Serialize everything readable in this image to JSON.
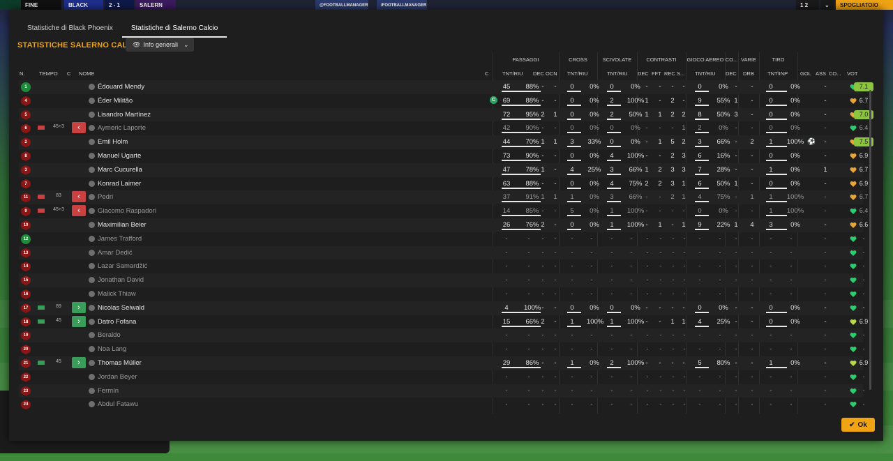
{
  "topbar": {
    "status": "FINE PARTITA",
    "home": "BLACK",
    "score": "2 - 1",
    "away": "SALERN",
    "social1": "@FOOTBALLMANAGER",
    "social2": "/FOOTBALLMANAGER",
    "right_score": "1 2",
    "right_btn": "SPOGLIATOIO"
  },
  "tabs": [
    "Statistiche di Black Phoenix",
    "Statistiche di Salerno Calcio"
  ],
  "title": "STATISTICHE SALERNO CALCIO",
  "view_select": "Info generali",
  "groups": {
    "passaggi": "PASSAGGI",
    "cross": "CROSS",
    "scivolate": "SCIVOLATE",
    "contrasti": "CONTRASTI",
    "aereo": "GIOCO AEREO",
    "co": "CO...",
    "varie": "VARIE",
    "tiro": "TIRO"
  },
  "headers": {
    "n": "N.",
    "tempo": "TEMPO",
    "c": "C",
    "nome": "NOME",
    "cap": "C",
    "tnt_riu": "TNT/RIU",
    "dec": "DEC",
    "ocn": "OCN",
    "cross_tnt": "TNT/RIU",
    "sci_tnt": "TNT/RIU",
    "c_dec": "DEC",
    "c_fft": "FFT",
    "c_rec": "REC",
    "c_s": "S...",
    "aer_tnt": "TNT/RIU",
    "co_dec": "DEC",
    "drb": "DRB",
    "tiro_tnt": "TNT\\INP",
    "gol": "GOL",
    "ass": "ASS",
    "cond": "CO...",
    "vot": "VOT"
  },
  "players": [
    {
      "n": "1",
      "gk": true,
      "tempo": "",
      "sub": "",
      "name": "Édouard Mendy",
      "dim": false,
      "cap": false,
      "p": [
        "45",
        "88%"
      ],
      "pdec": "-",
      "pocn": "-",
      "cr": [
        "0",
        "0%"
      ],
      "sc": [
        "0",
        "0%"
      ],
      "ct": [
        "-",
        "-",
        "-",
        "-"
      ],
      "aer": [
        "0",
        "0%"
      ],
      "codec": "-",
      "drb": "-",
      "tiro": [
        "0",
        "0%"
      ],
      "gol": "",
      "ass": "-",
      "heart": "green",
      "vot": "7.1",
      "good": true
    },
    {
      "n": "4",
      "tempo": "",
      "sub": "",
      "name": "Éder Militão",
      "cap": true,
      "p": [
        "69",
        "88%"
      ],
      "pdec": "-",
      "pocn": "-",
      "cr": [
        "0",
        "0%"
      ],
      "sc": [
        "2",
        "100%"
      ],
      "ct": [
        "1",
        "-",
        "2",
        "-"
      ],
      "aer": [
        "9",
        "55%"
      ],
      "codec": "1",
      "drb": "-",
      "tiro": [
        "0",
        "0%"
      ],
      "gol": "",
      "ass": "-",
      "heart": "orange",
      "vot": "6.7"
    },
    {
      "n": "5",
      "tempo": "",
      "sub": "",
      "name": "Lisandro Martínez",
      "p": [
        "72",
        "95%"
      ],
      "pdec": "2",
      "pocn": "1",
      "cr": [
        "0",
        "0%"
      ],
      "sc": [
        "2",
        "50%"
      ],
      "ct": [
        "1",
        "1",
        "2",
        "2"
      ],
      "aer": [
        "8",
        "50%"
      ],
      "codec": "3",
      "drb": "-",
      "tiro": [
        "0",
        "0%"
      ],
      "gol": "",
      "ass": "-",
      "heart": "orange",
      "vot": "7.0",
      "good": true
    },
    {
      "n": "6",
      "tempo": "45+3",
      "sub": "out",
      "name": "Aymeric Laporte",
      "dim": true,
      "p": [
        "42",
        "90%"
      ],
      "pdec": "-",
      "pocn": "-",
      "cr": [
        "0",
        "0%"
      ],
      "sc": [
        "0",
        "0%"
      ],
      "ct": [
        "-",
        "-",
        "-",
        "1"
      ],
      "aer": [
        "2",
        "0%"
      ],
      "codec": "-",
      "drb": "-",
      "tiro": [
        "0",
        "0%"
      ],
      "gol": "",
      "ass": "-",
      "heart": "green",
      "vot": "6.4"
    },
    {
      "n": "2",
      "tempo": "",
      "sub": "",
      "name": "Emil Holm",
      "p": [
        "44",
        "70%"
      ],
      "pdec": "1",
      "pocn": "1",
      "cr": [
        "3",
        "33%"
      ],
      "sc": [
        "0",
        "0%"
      ],
      "ct": [
        "-",
        "1",
        "5",
        "2"
      ],
      "aer": [
        "3",
        "66%"
      ],
      "codec": "-",
      "drb": "2",
      "tiro": [
        "1",
        "100%"
      ],
      "gol": "⚽",
      "ass": "-",
      "heart": "orange",
      "vot": "7.5",
      "good": true
    },
    {
      "n": "8",
      "tempo": "",
      "sub": "",
      "name": "Manuel Ugarte",
      "p": [
        "73",
        "90%"
      ],
      "pdec": "-",
      "pocn": "-",
      "cr": [
        "0",
        "0%"
      ],
      "sc": [
        "4",
        "100%"
      ],
      "ct": [
        "-",
        "-",
        "2",
        "3"
      ],
      "aer": [
        "6",
        "16%"
      ],
      "codec": "-",
      "drb": "-",
      "tiro": [
        "0",
        "0%"
      ],
      "gol": "",
      "ass": "-",
      "heart": "orange",
      "vot": "6.9"
    },
    {
      "n": "3",
      "tempo": "",
      "sub": "",
      "name": "Marc Cucurella",
      "p": [
        "47",
        "78%"
      ],
      "pdec": "1",
      "pocn": "-",
      "cr": [
        "4",
        "25%"
      ],
      "sc": [
        "3",
        "66%"
      ],
      "ct": [
        "1",
        "2",
        "3",
        "3"
      ],
      "aer": [
        "7",
        "28%"
      ],
      "codec": "-",
      "drb": "-",
      "tiro": [
        "1",
        "0%"
      ],
      "gol": "",
      "ass": "1",
      "heart": "orange",
      "vot": "6.7"
    },
    {
      "n": "7",
      "tempo": "",
      "sub": "",
      "name": "Konrad Laimer",
      "p": [
        "63",
        "88%"
      ],
      "pdec": "-",
      "pocn": "-",
      "cr": [
        "0",
        "0%"
      ],
      "sc": [
        "4",
        "75%"
      ],
      "ct": [
        "2",
        "2",
        "3",
        "1"
      ],
      "aer": [
        "6",
        "50%"
      ],
      "codec": "1",
      "drb": "-",
      "tiro": [
        "0",
        "0%"
      ],
      "gol": "",
      "ass": "-",
      "heart": "orange",
      "vot": "6.9"
    },
    {
      "n": "11",
      "tempo": "83",
      "sub": "out",
      "name": "Pedri",
      "dim": true,
      "p": [
        "37",
        "91%"
      ],
      "pdec": "1",
      "pocn": "1",
      "cr": [
        "1",
        "0%"
      ],
      "sc": [
        "3",
        "66%"
      ],
      "ct": [
        "-",
        "-",
        "2",
        "1"
      ],
      "aer": [
        "4",
        "75%"
      ],
      "codec": "-",
      "drb": "1",
      "tiro": [
        "1",
        "100%"
      ],
      "gol": "",
      "ass": "-",
      "heart": "orange",
      "vot": "6.7"
    },
    {
      "n": "9",
      "tempo": "45+3",
      "sub": "out",
      "name": "Giacomo Raspadori",
      "dim": true,
      "p": [
        "14",
        "85%"
      ],
      "pdec": "-",
      "pocn": "-",
      "cr": [
        "5",
        "0%"
      ],
      "sc": [
        "1",
        "100%"
      ],
      "ct": [
        "-",
        "-",
        "-",
        "-"
      ],
      "aer": [
        "0",
        "0%"
      ],
      "codec": "-",
      "drb": "-",
      "tiro": [
        "1",
        "100%"
      ],
      "gol": "",
      "ass": "-",
      "heart": "green",
      "vot": "6.4"
    },
    {
      "n": "10",
      "tempo": "",
      "sub": "",
      "name": "Maximilian Beier",
      "p": [
        "26",
        "76%"
      ],
      "pdec": "2",
      "pocn": "-",
      "cr": [
        "0",
        "0%"
      ],
      "sc": [
        "1",
        "100%"
      ],
      "ct": [
        "-",
        "1",
        "-",
        "1"
      ],
      "aer": [
        "9",
        "22%"
      ],
      "codec": "1",
      "drb": "4",
      "tiro": [
        "3",
        "0%"
      ],
      "gol": "",
      "ass": "-",
      "heart": "orange",
      "vot": "6.6"
    },
    {
      "n": "12",
      "gk": true,
      "tempo": "",
      "sub": "",
      "name": "James Trafford",
      "dim": true,
      "empty": true,
      "heart": "green",
      "vot": "-"
    },
    {
      "n": "13",
      "tempo": "",
      "sub": "",
      "name": "Amar Dedić",
      "dim": true,
      "empty": true,
      "heart": "green",
      "vot": "-"
    },
    {
      "n": "14",
      "tempo": "",
      "sub": "",
      "name": "Lazar Samardžić",
      "dim": true,
      "empty": true,
      "heart": "green",
      "vot": "-"
    },
    {
      "n": "15",
      "tempo": "",
      "sub": "",
      "name": "Jonathan David",
      "dim": true,
      "empty": true,
      "heart": "green",
      "vot": "-"
    },
    {
      "n": "16",
      "tempo": "",
      "sub": "",
      "name": "Malick Thiaw",
      "dim": true,
      "empty": true,
      "heart": "green",
      "vot": "-"
    },
    {
      "n": "17",
      "tempo": "89",
      "sub": "in",
      "name": "Nicolas Seiwald",
      "p": [
        "4",
        "100%"
      ],
      "pdec": "-",
      "pocn": "-",
      "cr": [
        "0",
        "0%"
      ],
      "sc": [
        "0",
        "0%"
      ],
      "ct": [
        "-",
        "-",
        "-",
        "-"
      ],
      "aer": [
        "0",
        "0%"
      ],
      "codec": "-",
      "drb": "-",
      "tiro": [
        "0",
        "0%"
      ],
      "gol": "",
      "ass": "-",
      "heart": "green",
      "vot": "-"
    },
    {
      "n": "18",
      "tempo": "45",
      "sub": "in",
      "name": "Datro Fofana",
      "p": [
        "15",
        "66%"
      ],
      "pdec": "2",
      "pocn": "-",
      "cr": [
        "1",
        "100%"
      ],
      "sc": [
        "1",
        "100%"
      ],
      "ct": [
        "-",
        "-",
        "1",
        "1"
      ],
      "aer": [
        "4",
        "25%"
      ],
      "codec": "-",
      "drb": "-",
      "tiro": [
        "0",
        "0%"
      ],
      "gol": "",
      "ass": "-",
      "heart": "lime",
      "vot": "6.9"
    },
    {
      "n": "19",
      "tempo": "",
      "sub": "",
      "name": "Beraldo",
      "dim": true,
      "empty": true,
      "heart": "green",
      "vot": "-"
    },
    {
      "n": "20",
      "tempo": "",
      "sub": "",
      "name": "Noa Lang",
      "dim": true,
      "empty": true,
      "heart": "green",
      "vot": "-"
    },
    {
      "n": "21",
      "tempo": "45",
      "sub": "in",
      "name": "Thomas Müller",
      "p": [
        "29",
        "86%"
      ],
      "pdec": "-",
      "pocn": "-",
      "cr": [
        "1",
        "0%"
      ],
      "sc": [
        "2",
        "100%"
      ],
      "ct": [
        "-",
        "-",
        "-",
        "-"
      ],
      "aer": [
        "5",
        "80%"
      ],
      "codec": "-",
      "drb": "-",
      "tiro": [
        "1",
        "0%"
      ],
      "gol": "",
      "ass": "-",
      "heart": "lime",
      "vot": "6.9"
    },
    {
      "n": "22",
      "tempo": "",
      "sub": "",
      "name": "Jordan Beyer",
      "dim": true,
      "empty": true,
      "heart": "green",
      "vot": "-"
    },
    {
      "n": "23",
      "tempo": "",
      "sub": "",
      "name": "Fermín",
      "dim": true,
      "empty": true,
      "heart": "green",
      "vot": "-"
    },
    {
      "n": "24",
      "tempo": "",
      "sub": "",
      "name": "Abdul Fatawu",
      "dim": true,
      "empty": true,
      "heart": "green",
      "vot": "-"
    }
  ],
  "ok_label": "Ok",
  "colors": {
    "accent": "#f0a313",
    "green": "#2ecc71",
    "orange": "#e8a63a",
    "lime": "#b7d94a",
    "vote_good": "#8cc63f"
  }
}
